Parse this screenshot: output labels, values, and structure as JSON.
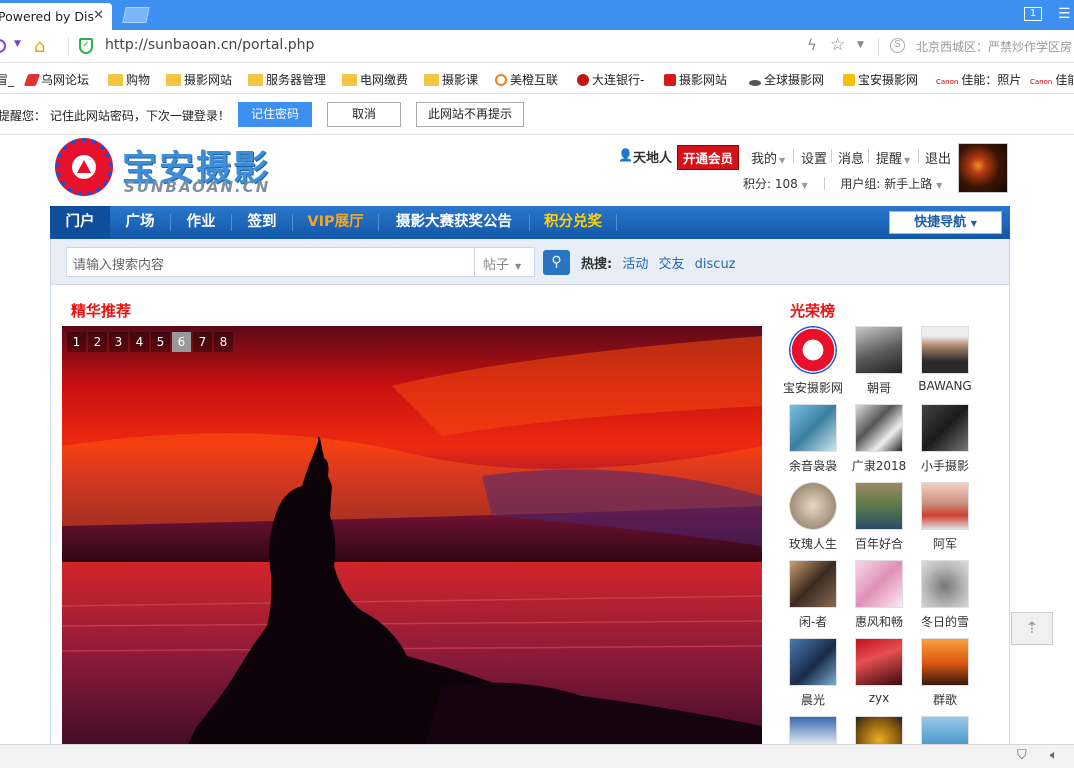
{
  "browser": {
    "tab_title": "Powered by Dis",
    "url": "http://sunbaoan.cn/portal.php",
    "search_hint": "北京西城区：严禁炒作学区房"
  },
  "bookmarks": [
    {
      "label": "乌网论坛",
      "icon": "bird-icon"
    },
    {
      "label": "购物",
      "icon": "folder-icon"
    },
    {
      "label": "摄影网站",
      "icon": "folder-icon"
    },
    {
      "label": "服务器管理",
      "icon": "folder-icon"
    },
    {
      "label": "电网缴费",
      "icon": "folder-icon"
    },
    {
      "label": "摄影课",
      "icon": "folder-icon"
    },
    {
      "label": "美橙互联",
      "icon": "orange-icon"
    },
    {
      "label": "大连银行-",
      "icon": "bank-icon"
    },
    {
      "label": "摄影网站",
      "icon": "camera-site-icon"
    },
    {
      "label": "全球摄影网",
      "icon": "globe-icon"
    },
    {
      "label": "宝安摄影网",
      "icon": "badge-icon"
    },
    {
      "label": "佳能：照片",
      "icon": "canon-icon"
    },
    {
      "label": "佳能",
      "icon": "canon-icon"
    }
  ],
  "password_prompt": {
    "message": "提醒您：  记住此网站密码，下次一键登录！",
    "save": "记住密码",
    "cancel": "取消",
    "never": "此网站不再提示"
  },
  "site": {
    "logo_text": "宝安摄影",
    "logo_sub": "SUNBAOAN.CN"
  },
  "user": {
    "name": "天地人",
    "vip": "开通会员",
    "menu": [
      "我的",
      "设置",
      "消息",
      "提醒",
      "退出"
    ],
    "points": "积分: 108",
    "group": "用户组: 新手上路"
  },
  "nav": {
    "items": [
      "门户",
      "广场",
      "作业",
      "签到",
      "VIP展厅",
      "摄影大赛获奖公告",
      "积分兑奖"
    ],
    "quick": "快捷导航"
  },
  "search": {
    "placeholder": "请输入搜索内容",
    "type": "帖子",
    "hot_label": "热搜:",
    "hot": [
      "活动",
      "交友",
      "discuz"
    ]
  },
  "featured": {
    "title": "精华推荐",
    "slides": [
      "1",
      "2",
      "3",
      "4",
      "5",
      "6",
      "7",
      "8"
    ],
    "active_slide": "6"
  },
  "honor": {
    "title": "光荣榜",
    "members": [
      "宝安摄影网",
      "朝哥",
      "BAWANG",
      "余音袅袅",
      "广隶2018",
      "小手摄影",
      "玫瑰人生",
      "百年好合",
      "阿军",
      "闲-者",
      "惠风和畅",
      "冬日的雪",
      "晨光",
      "zyx",
      "群歌"
    ]
  },
  "colors": {
    "browser_blue": "#3d8ff0",
    "nav_blue": "#1662b8",
    "vip_red": "#d5121a",
    "title_red": "#e11111",
    "vip_orange": "#f5a623",
    "points_yellow": "#ffd200"
  }
}
